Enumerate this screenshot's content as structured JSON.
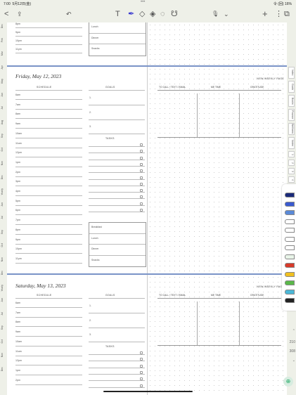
{
  "status": {
    "time": "7:00",
    "date": "5月12日(金)",
    "right": "令 (回) 16%"
  },
  "toolbar": {
    "back": "<",
    "share": "⇪",
    "undo": "↶",
    "text": "T",
    "pen": "✒",
    "highlighter": "◇",
    "eraser": "◈",
    "lasso": "◌",
    "shapes": "☋",
    "mic": "🎙",
    "micdown": "⌄",
    "add": "+",
    "more": "⋮",
    "pages": "⧉"
  },
  "left_tabs": [
    "Dec",
    "Feb",
    "Mar",
    "Apr",
    "May",
    "Jun",
    "Jul",
    "Aug",
    "Sep",
    "Oct",
    "Nov",
    "Dec",
    "Yearly",
    "Jun",
    "Jul",
    "Sep",
    "Oct",
    "Nov",
    "Dec",
    "Yearly",
    "Jun",
    "Jul",
    "Sep",
    "Oct",
    "Nov",
    "Dec"
  ],
  "right_tabs": [
    "Index",
    "Goals",
    "Books",
    "Finance",
    "Wellness",
    "Notes",
    "1",
    "2",
    "3",
    "4"
  ],
  "page1": {
    "hours": [
      "8pm",
      "9pm",
      "10pm",
      "11pm"
    ],
    "meals": [
      "Lunch",
      "Dinner",
      "Snacks"
    ]
  },
  "page2": {
    "date": "Friday, May 12, 2023",
    "schedule": "SCHEDULE",
    "goals": "GOALS",
    "tasks": "TASKS",
    "view_weekly": "VIEW WEEKLY PAGE",
    "hours": [
      "6am",
      "7am",
      "8am",
      "9am",
      "10am",
      "11am",
      "12pm",
      "1pm",
      "2pm",
      "3pm",
      "4pm",
      "5pm",
      "6pm",
      "7pm",
      "8pm",
      "9pm",
      "10pm",
      "11pm"
    ],
    "goal_nums": [
      "1.",
      "2.",
      "3."
    ],
    "meals": [
      "Breakfast",
      "Lunch",
      "Dinner",
      "Snacks"
    ],
    "call_cols": [
      "TO CALL / TEXT / EMAIL",
      "ME TIME",
      "GRATITUDE"
    ]
  },
  "page3": {
    "date": "Saturday, May 13, 2023",
    "schedule": "SCHEDULE",
    "goals": "GOALS",
    "tasks": "TASKS",
    "view_weekly": "VIEW WEEKLY PAGE",
    "hours": [
      "6am",
      "7am",
      "8am",
      "9am",
      "10am",
      "11am",
      "12pm",
      "1pm",
      "2pm"
    ],
    "goal_nums": [
      "1.",
      "2.",
      "3."
    ],
    "call_cols": [
      "TO CALL / TEXT / EMAIL",
      "ME TIME",
      "GRATITUDE"
    ]
  },
  "pagenum": {
    "current": "210",
    "total": "308"
  },
  "palette_colors": [
    "#1a2a7a",
    "#3a5ad0",
    "#5a8ad8",
    "#ffffff",
    "#ffffff",
    "#ffffff",
    "#ffffff",
    "#e8f4e8",
    "#d83a2a",
    "#f0c020",
    "#5ab84a",
    "#4ab8d8",
    "#222222"
  ]
}
